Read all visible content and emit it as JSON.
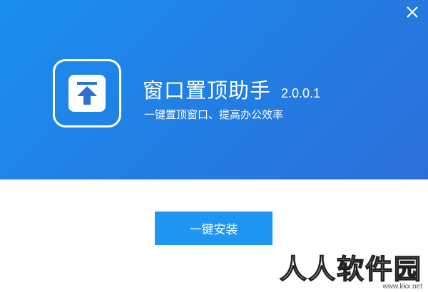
{
  "app": {
    "name": "窗口置顶助手",
    "version": "2.0.0.1",
    "subtitle": "一键置顶窗口、提高办公效率"
  },
  "actions": {
    "install_label": "一键安装"
  },
  "watermark": {
    "text": "人人软件园",
    "url": "www.kkx.net"
  },
  "icons": {
    "close": "close-icon",
    "logo": "pin-to-top-icon"
  },
  "colors": {
    "header_start": "#1a8ef0",
    "header_end": "#2a6fd8",
    "button": "#1e96f2",
    "logo_glyph": "#2a72d6"
  }
}
